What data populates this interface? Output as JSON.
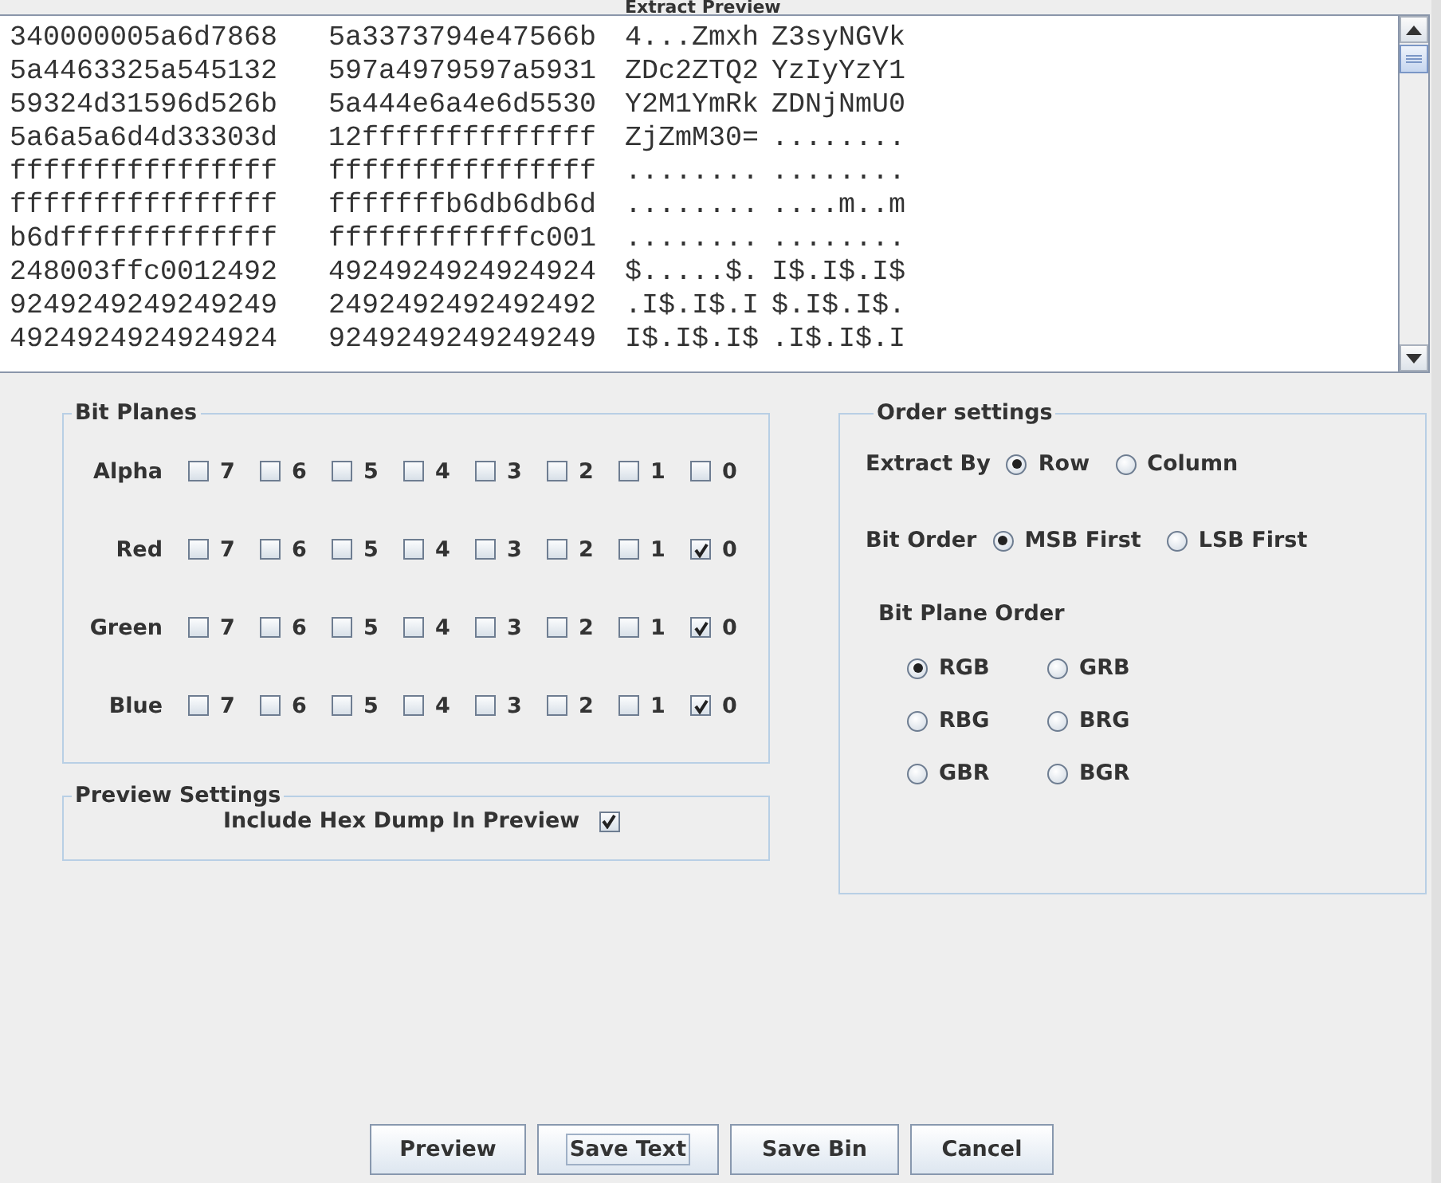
{
  "preview": {
    "title": "Extract Preview",
    "rows": [
      {
        "cells": [
          "340000005a6d7868",
          "5a3373794e47566b",
          "4...Zmxh",
          "Z3syNGVk"
        ]
      },
      {
        "cells": [
          "5a4463325a545132",
          "597a4979597a5931",
          "ZDc2ZTQ2",
          "YzIyYzY1"
        ]
      },
      {
        "cells": [
          "59324d31596d526b",
          "5a444e6a4e6d5530",
          "Y2M1YmRk",
          "ZDNjNmU0"
        ]
      },
      {
        "cells": [
          "5a6a5a6d4d33303d",
          "12ffffffffffffff",
          "ZjZmM30=",
          "........"
        ]
      },
      {
        "cells": [
          "ffffffffffffffff",
          "ffffffffffffffff",
          "........",
          "........"
        ]
      },
      {
        "cells": [
          "ffffffffffffffff",
          "fffffffb6db6db6d",
          "........",
          "....m..m"
        ]
      },
      {
        "cells": [
          "b6dfffffffffffff",
          "ffffffffffffc001",
          "........",
          "........"
        ]
      },
      {
        "cells": [
          "248003ffc0012492",
          "4924924924924924",
          "$.....$.",
          "I$.I$.I$"
        ]
      },
      {
        "cells": [
          "9249249249249249",
          "2492492492492492",
          ".I$.I$.I",
          "$.I$.I$."
        ]
      },
      {
        "cells": [
          "4924924924924924",
          "9249249249249249",
          "I$.I$.I$",
          ".I$.I$.I"
        ]
      }
    ]
  },
  "bit_planes": {
    "title": "Bit Planes",
    "channels": [
      {
        "name": "Alpha",
        "bits": [
          {
            "label": "7",
            "checked": false
          },
          {
            "label": "6",
            "checked": false
          },
          {
            "label": "5",
            "checked": false
          },
          {
            "label": "4",
            "checked": false
          },
          {
            "label": "3",
            "checked": false
          },
          {
            "label": "2",
            "checked": false
          },
          {
            "label": "1",
            "checked": false
          },
          {
            "label": "0",
            "checked": false
          }
        ]
      },
      {
        "name": "Red",
        "bits": [
          {
            "label": "7",
            "checked": false
          },
          {
            "label": "6",
            "checked": false
          },
          {
            "label": "5",
            "checked": false
          },
          {
            "label": "4",
            "checked": false
          },
          {
            "label": "3",
            "checked": false
          },
          {
            "label": "2",
            "checked": false
          },
          {
            "label": "1",
            "checked": false
          },
          {
            "label": "0",
            "checked": true
          }
        ]
      },
      {
        "name": "Green",
        "bits": [
          {
            "label": "7",
            "checked": false
          },
          {
            "label": "6",
            "checked": false
          },
          {
            "label": "5",
            "checked": false
          },
          {
            "label": "4",
            "checked": false
          },
          {
            "label": "3",
            "checked": false
          },
          {
            "label": "2",
            "checked": false
          },
          {
            "label": "1",
            "checked": false
          },
          {
            "label": "0",
            "checked": true
          }
        ]
      },
      {
        "name": "Blue",
        "bits": [
          {
            "label": "7",
            "checked": false
          },
          {
            "label": "6",
            "checked": false
          },
          {
            "label": "5",
            "checked": false
          },
          {
            "label": "4",
            "checked": false
          },
          {
            "label": "3",
            "checked": false
          },
          {
            "label": "2",
            "checked": false
          },
          {
            "label": "1",
            "checked": false
          },
          {
            "label": "0",
            "checked": true
          }
        ]
      }
    ]
  },
  "preview_settings": {
    "title": "Preview Settings",
    "option": {
      "label": "Include Hex Dump In Preview",
      "checked": true
    }
  },
  "order_settings": {
    "title": "Order settings",
    "extract_by": {
      "label": "Extract By",
      "options": [
        {
          "label": "Row",
          "selected": true
        },
        {
          "label": "Column",
          "selected": false
        }
      ]
    },
    "bit_order": {
      "label": "Bit Order",
      "options": [
        {
          "label": "MSB First",
          "selected": true
        },
        {
          "label": "LSB First",
          "selected": false
        }
      ]
    },
    "bit_plane_order": {
      "label": "Bit Plane Order",
      "options": [
        {
          "label": "RGB",
          "selected": true
        },
        {
          "label": "GRB",
          "selected": false
        },
        {
          "label": "RBG",
          "selected": false
        },
        {
          "label": "BRG",
          "selected": false
        },
        {
          "label": "GBR",
          "selected": false
        },
        {
          "label": "BGR",
          "selected": false
        }
      ]
    }
  },
  "buttons": [
    {
      "label": "Preview",
      "focused": false
    },
    {
      "label": "Save Text",
      "focused": true
    },
    {
      "label": "Save Bin",
      "focused": false
    },
    {
      "label": "Cancel",
      "focused": false
    }
  ]
}
